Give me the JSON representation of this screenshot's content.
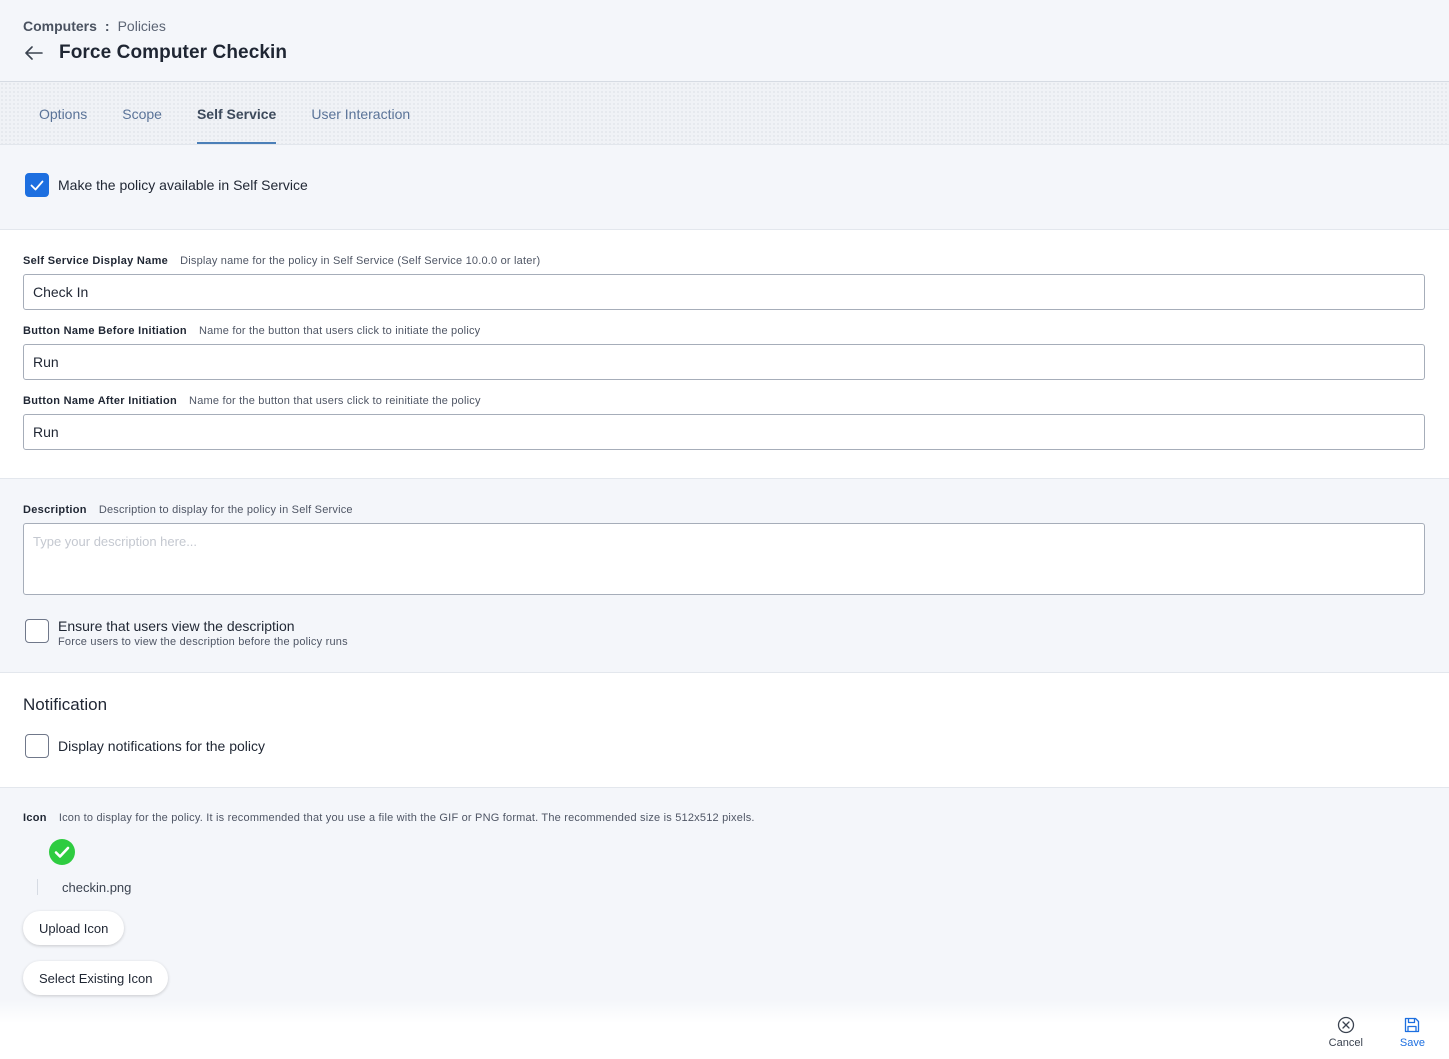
{
  "breadcrumb": {
    "parent": "Computers",
    "separator": ":",
    "current": "Policies"
  },
  "page": {
    "title": "Force Computer Checkin"
  },
  "tabs": [
    {
      "label": "Options",
      "active": false
    },
    {
      "label": "Scope",
      "active": false
    },
    {
      "label": "Self Service",
      "active": true
    },
    {
      "label": "User Interaction",
      "active": false
    }
  ],
  "availability": {
    "label": "Make the policy available in Self Service",
    "checked": true
  },
  "fields": {
    "display_name": {
      "label": "Self Service Display Name",
      "hint": "Display name for the policy in Self Service (Self Service 10.0.0 or later)",
      "value": "Check In"
    },
    "button_before": {
      "label": "Button Name Before Initiation",
      "hint": "Name for the button that users click to initiate the policy",
      "value": "Run"
    },
    "button_after": {
      "label": "Button Name After Initiation",
      "hint": "Name for the button that users click to reinitiate the policy",
      "value": "Run"
    }
  },
  "description": {
    "label": "Description",
    "hint": "Description to display for the policy in Self Service",
    "placeholder": "Type your description here...",
    "ensure_label": "Ensure that users view the description",
    "ensure_hint": "Force users to view the description before the policy runs",
    "ensure_checked": false
  },
  "notification": {
    "title": "Notification",
    "label": "Display notifications for the policy",
    "checked": false
  },
  "icon": {
    "label": "Icon",
    "hint": "Icon to display for the policy. It is recommended that you use a file with the GIF or PNG format. The recommended size is 512x512 pixels.",
    "filename": "checkin.png",
    "preview_color": "#2ecc40",
    "upload_label": "Upload Icon",
    "select_label": "Select Existing Icon"
  },
  "footer": {
    "cancel_label": "Cancel",
    "save_label": "Save"
  },
  "colors": {
    "accent": "#1d6fe0",
    "tab_inactive": "#5a7398",
    "tab_underline": "#4b7fb8"
  }
}
